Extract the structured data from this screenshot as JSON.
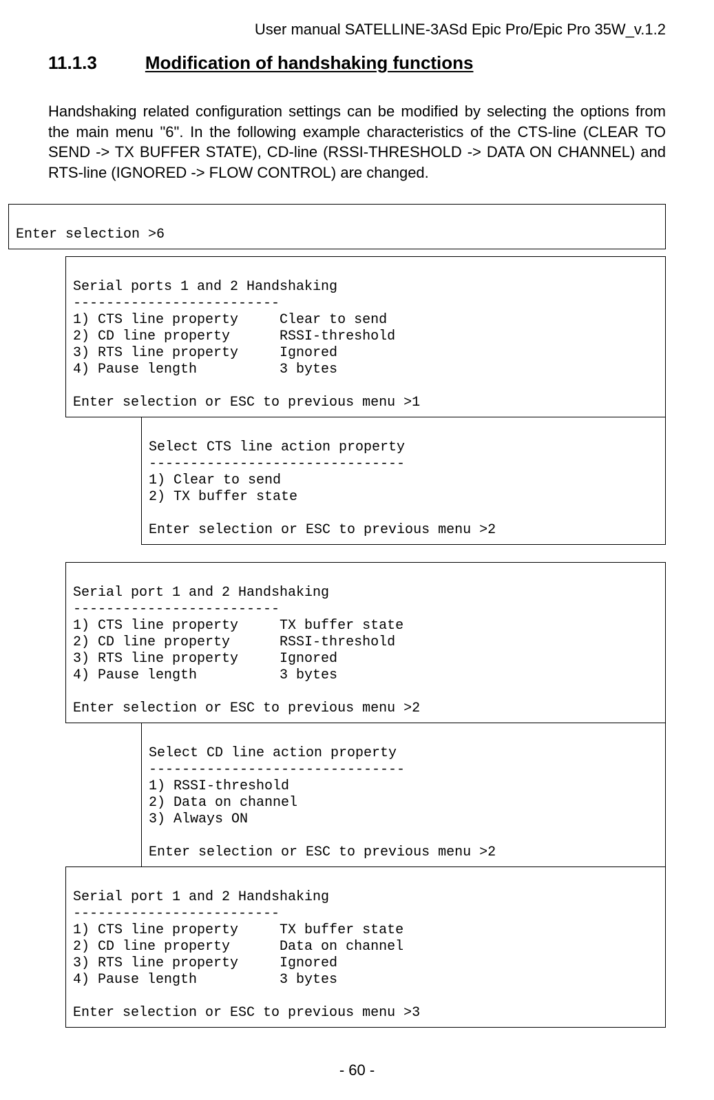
{
  "header": "User manual SATELLINE-3ASd Epic Pro/Epic Pro 35W_v.1.2",
  "section": {
    "number": "11.1.3",
    "title": "Modification of handshaking functions"
  },
  "intro": "Handshaking related configuration settings can be modified by selecting the options from the main menu \"6\". In the following example characteristics of the CTS-line (CLEAR TO SEND -> TX BUFFER STATE), CD-line (RSSI-THRESHOLD -> DATA ON CHANNEL) and RTS-line (IGNORED\n-> FLOW CONTROL) are changed.",
  "boxes": {
    "b1": "\nEnter selection >6\n",
    "b2": "\nSerial ports 1 and 2 Handshaking\n-------------------------\n1) CTS line property     Clear to send\n2) CD line property      RSSI-threshold\n3) RTS line property     Ignored\n4) Pause length          3 bytes\n\nEnter selection or ESC to previous menu >1",
    "b3": "\nSelect CTS line action property\n-------------------------------\n1) Clear to send\n2) TX buffer state\n\nEnter selection or ESC to previous menu >2",
    "b4": "\nSerial port 1 and 2 Handshaking\n-------------------------\n1) CTS line property     TX buffer state\n2) CD line property      RSSI-threshold\n3) RTS line property     Ignored\n4) Pause length          3 bytes\n\nEnter selection or ESC to previous menu >2",
    "b5": "\nSelect CD line action property\n-------------------------------\n1) RSSI-threshold\n2) Data on channel\n3) Always ON\n\nEnter selection or ESC to previous menu >2",
    "b6": "\nSerial port 1 and 2 Handshaking\n-------------------------\n1) CTS line property     TX buffer state\n2) CD line property      Data on channel\n3) RTS line property     Ignored\n4) Pause length          3 bytes\n\nEnter selection or ESC to previous menu >3"
  },
  "footer": "- 60 -"
}
